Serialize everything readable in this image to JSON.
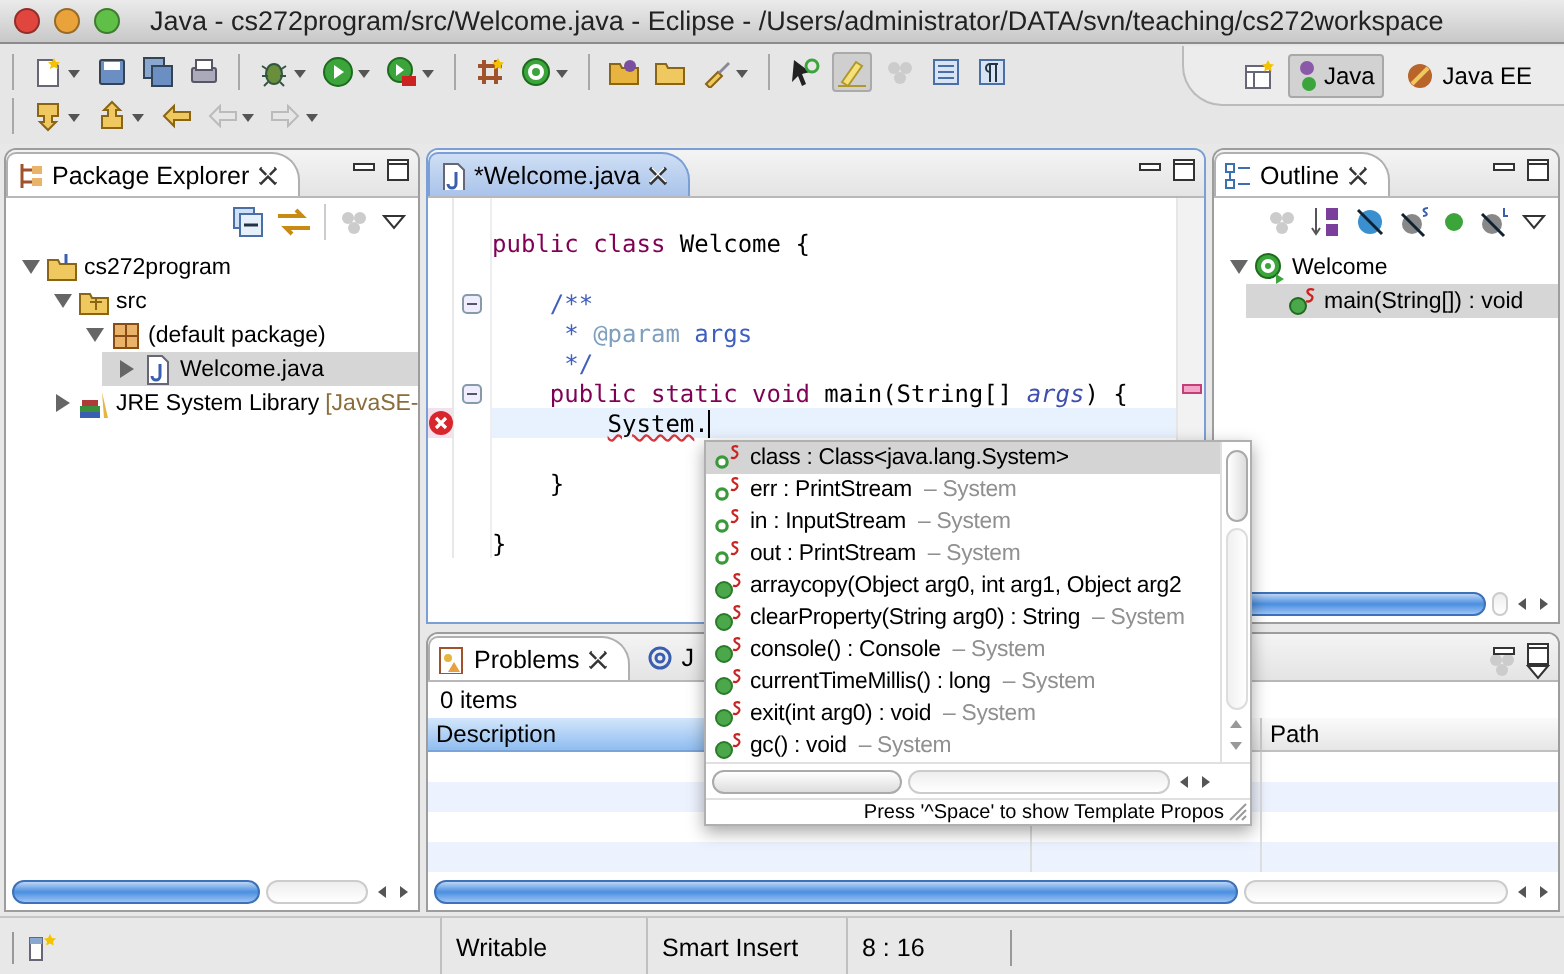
{
  "window": {
    "title": "Java - cs272program/src/Welcome.java - Eclipse - /Users/administrator/DATA/svn/teaching/cs272workspace"
  },
  "perspectives": [
    {
      "label": "Java",
      "selected": true
    },
    {
      "label": "Java EE",
      "selected": false
    }
  ],
  "package_explorer": {
    "title": "Package Explorer",
    "tree": [
      {
        "label": "cs272program",
        "kind": "project",
        "expanded": true,
        "selected": false,
        "children": [
          {
            "label": "src",
            "kind": "source-folder",
            "expanded": true,
            "selected": false,
            "children": [
              {
                "label": "(default package)",
                "kind": "package",
                "expanded": true,
                "selected": false,
                "children": [
                  {
                    "label": "Welcome.java",
                    "kind": "java-file",
                    "expanded": false,
                    "selected": true
                  }
                ]
              }
            ]
          },
          {
            "label": "JRE System Library",
            "suffix": "[JavaSE-",
            "kind": "library",
            "expanded": false,
            "selected": false
          }
        ]
      }
    ]
  },
  "editor": {
    "tab": "*Welcome.java",
    "lines": [
      {
        "fold": false,
        "error": false,
        "current": false
      },
      {
        "fold": false,
        "error": false,
        "current": false,
        "tokens": [
          {
            "t": "public class ",
            "kind": "keyword"
          },
          {
            "t": "Welcome {",
            "kind": "plain"
          }
        ]
      },
      {
        "fold": false,
        "error": false,
        "current": false
      },
      {
        "fold": true,
        "error": false,
        "current": false,
        "tokens": [
          {
            "t": "    /**",
            "kind": "doc"
          }
        ]
      },
      {
        "fold": false,
        "error": false,
        "current": false,
        "tokens": [
          {
            "t": "     * ",
            "kind": "doc"
          },
          {
            "t": "@param",
            "kind": "doctag"
          },
          {
            "t": " args",
            "kind": "doc"
          }
        ]
      },
      {
        "fold": false,
        "error": false,
        "current": false,
        "tokens": [
          {
            "t": "     */",
            "kind": "doc"
          }
        ]
      },
      {
        "fold": true,
        "error": false,
        "current": false,
        "tokens": [
          {
            "t": "    public static void ",
            "kind": "keyword"
          },
          {
            "t": "main(String[] ",
            "kind": "plain"
          },
          {
            "t": "args",
            "kind": "param"
          },
          {
            "t": ") {",
            "kind": "plain"
          }
        ]
      },
      {
        "fold": false,
        "error": true,
        "current": true,
        "tokens": [
          {
            "t": "        System",
            "kind": "error"
          },
          {
            "t": ".",
            "kind": "plain"
          }
        ]
      },
      {
        "fold": false,
        "error": false,
        "current": false
      },
      {
        "fold": false,
        "error": false,
        "current": false,
        "tokens": [
          {
            "t": "    }",
            "kind": "plain"
          }
        ]
      },
      {
        "fold": false,
        "error": false,
        "current": false
      },
      {
        "fold": false,
        "error": false,
        "current": false,
        "tokens": [
          {
            "t": "}",
            "kind": "plain"
          }
        ]
      }
    ]
  },
  "completion": {
    "items": [
      {
        "kind": "field",
        "text": "class : Class<java.lang.System>",
        "selected": true
      },
      {
        "kind": "field",
        "text": "err : PrintStream",
        "owner": "– System",
        "selected": false
      },
      {
        "kind": "field",
        "text": "in : InputStream",
        "owner": "– System",
        "selected": false
      },
      {
        "kind": "field",
        "text": "out : PrintStream",
        "owner": "– System",
        "selected": false
      },
      {
        "kind": "method",
        "text": "arraycopy(Object arg0, int arg1, Object arg2",
        "selected": false
      },
      {
        "kind": "method",
        "text": "clearProperty(String arg0) : String",
        "owner": "– System",
        "selected": false
      },
      {
        "kind": "method",
        "text": "console() : Console",
        "owner": "– System",
        "selected": false
      },
      {
        "kind": "method",
        "text": "currentTimeMillis() : long",
        "owner": "– System",
        "selected": false
      },
      {
        "kind": "method",
        "text": "exit(int arg0) : void",
        "owner": "– System",
        "selected": false
      },
      {
        "kind": "method",
        "text": "gc() : void",
        "owner": "– System",
        "selected": false
      }
    ],
    "hint": "Press '^Space' to show Template Propos"
  },
  "outline": {
    "title": "Outline",
    "tree": [
      {
        "label": "Welcome",
        "kind": "class",
        "expanded": true,
        "selected": false,
        "children": [
          {
            "label": "main(String[]) : void",
            "kind": "method",
            "expanded": false,
            "selected": true
          }
        ]
      }
    ]
  },
  "problems": {
    "tabs": [
      {
        "label": "Problems",
        "selected": true
      },
      {
        "label": "J",
        "selected": false
      }
    ],
    "count": "0 items",
    "columns": [
      "Description",
      "Path"
    ]
  },
  "status_bar": [
    "Writable",
    "Smart Insert",
    "8 : 16"
  ]
}
